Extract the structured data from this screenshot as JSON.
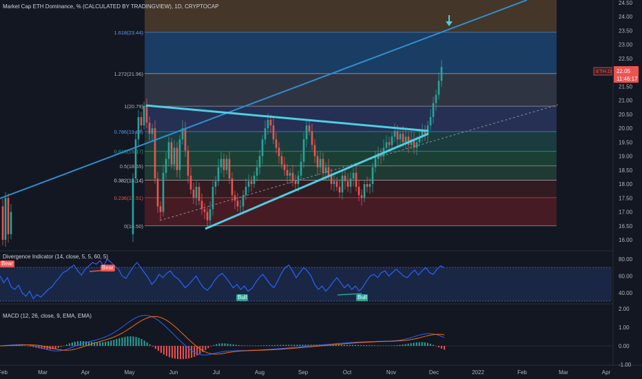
{
  "header": {
    "title": "Market Cap ETH Dominance, % (CALCULATED BY TRADINGVIEW), 1D, CRYPTOCAP"
  },
  "price_axis": {
    "ticks": [
      "24.50",
      "24.00",
      "23.50",
      "23.00",
      "22.50",
      "22.00",
      "21.50",
      "21.00",
      "20.50",
      "20.00",
      "19.50",
      "19.00",
      "18.50",
      "18.00",
      "17.50",
      "17.00",
      "16.50",
      "16.00"
    ],
    "symbol_tag": "ETH.D",
    "last_price": "22.05",
    "countdown": "11:46:17"
  },
  "fib_levels": [
    {
      "label": "1.618(23.44)",
      "value": 23.44,
      "label_color": "#5b9cf6",
      "band_color": "#2a6f78"
    },
    {
      "label": "1.272(21.96)",
      "value": 21.96,
      "label_color": "#b2b5be",
      "band_color": "#1e4b7a"
    },
    {
      "label": "1(20.79)",
      "value": 20.79,
      "label_color": "#b2b5be",
      "band_color": "#3a3f4d"
    },
    {
      "label": "0.786(19.88)",
      "value": 19.88,
      "label_color": "#5b9cf6",
      "band_color": "#2c3a66"
    },
    {
      "label": "0.618(19.17)",
      "value": 19.17,
      "label_color": "#26a69a",
      "band_color": "#1d4a4a"
    },
    {
      "label": "0.5(18.65)",
      "value": 18.65,
      "label_color": "#b2b5be",
      "band_color": "#1f4d3a"
    },
    {
      "label": "0.382(18.14)",
      "value": 18.14,
      "label_color": "#d1d4dc",
      "band_color": "#24473a"
    },
    {
      "label": "0.236(17.51)",
      "value": 17.51,
      "label_color": "#ef5350",
      "band_color": "#3e1d22"
    },
    {
      "label": "0(16.50)",
      "value": 16.5,
      "label_color": "#b2b5be",
      "band_color": "#5a1e26"
    }
  ],
  "divergence": {
    "title": "Divergence Indicator (14, close, 5, 5, 60, 5)",
    "ticks": [
      "80.00",
      "60.00",
      "40.00"
    ],
    "labels": {
      "bear1": "Bear",
      "bear2": "Bear",
      "bull1": "Bull",
      "bull2": "Bull"
    }
  },
  "macd": {
    "title": "MACD (12, 26, close, 9, EMA, EMA)",
    "ticks": [
      "2.00",
      "1.00",
      "0.00",
      "-1.00"
    ]
  },
  "time_axis": {
    "labels": [
      "Feb",
      "Mar",
      "Apr",
      "May",
      "Jun",
      "Jul",
      "Aug",
      "Sep",
      "Oct",
      "Nov",
      "Dec",
      "2022",
      "Feb",
      "Mar",
      "Apr"
    ]
  },
  "colors": {
    "background": "#131722",
    "bull": "#26a69a",
    "bear": "#ef5350",
    "trendline": "#4fc3f7",
    "channel": "#1e88c8",
    "price_tag": "#ef5350"
  }
}
